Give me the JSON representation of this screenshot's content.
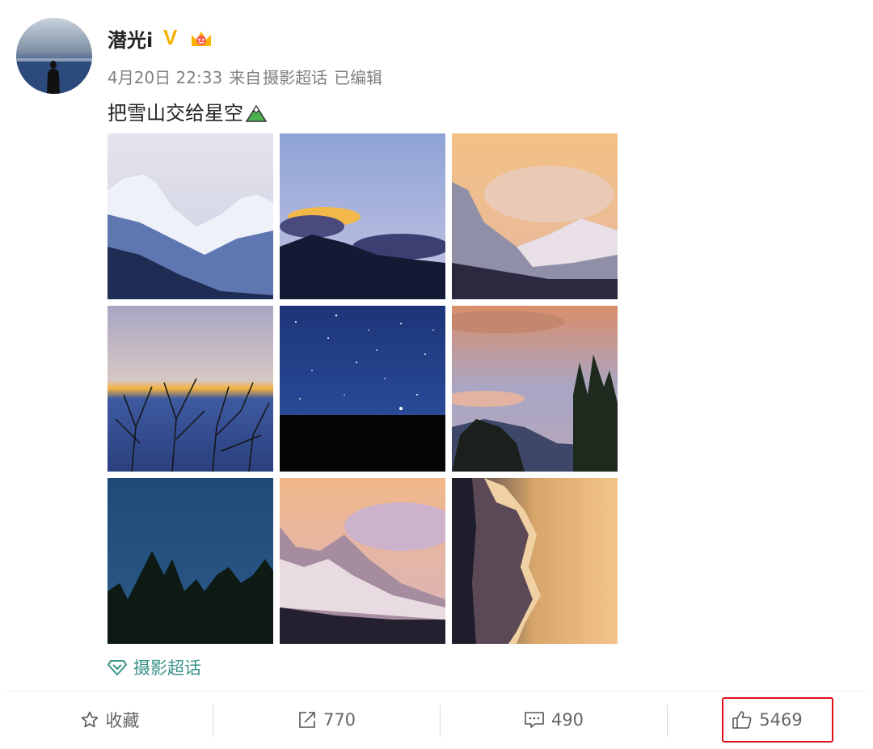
{
  "post": {
    "username": "潜光i",
    "verified_badge": "V",
    "timestamp": "4月20日 22:33",
    "source_prefix": "来自",
    "source": "摄影超话",
    "edited": "已编辑",
    "text": "把雪山交给星空",
    "topic": "摄影超话",
    "images": [
      {
        "subject": "snowy-mountain-blue"
      },
      {
        "subject": "golden-cloud-dusk"
      },
      {
        "subject": "misty-peaks-sunset"
      },
      {
        "subject": "lenticular-cloud-trees"
      },
      {
        "subject": "starry-night"
      },
      {
        "subject": "sunset-clouds-trees"
      },
      {
        "subject": "blue-hour-forest"
      },
      {
        "subject": "pink-mountain-clouds"
      },
      {
        "subject": "golden-mountain-rotated"
      }
    ]
  },
  "actions": {
    "favorite_label": "收藏",
    "repost_count": "770",
    "comment_count": "490",
    "like_count": "5469"
  },
  "colors": {
    "topic_green": "#3a9488",
    "highlight_red": "#e0101a",
    "badge_gold": "#f5b200"
  }
}
